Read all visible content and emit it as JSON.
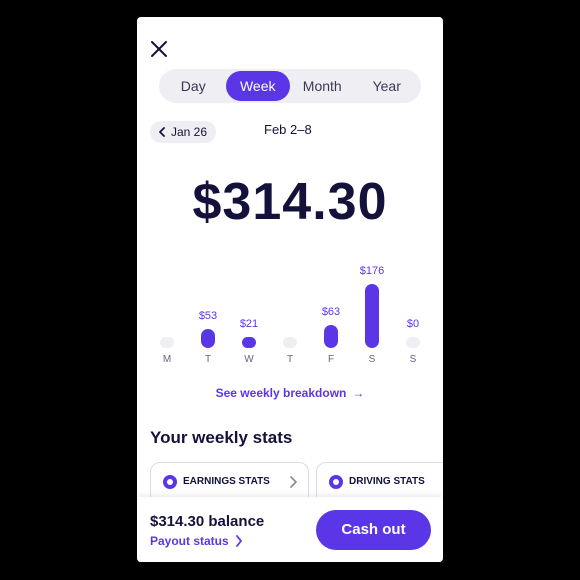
{
  "tabs": [
    {
      "label": "Day",
      "active": false
    },
    {
      "label": "Week",
      "active": true
    },
    {
      "label": "Month",
      "active": false
    },
    {
      "label": "Year",
      "active": false
    }
  ],
  "week_nav": {
    "prev_label": "Jan 26",
    "current_range": "Feb 2–8"
  },
  "total": "$314.30",
  "chart_data": {
    "type": "bar",
    "categories": [
      "M",
      "T",
      "W",
      "T",
      "F",
      "S",
      "S"
    ],
    "values": [
      0,
      53,
      21,
      0,
      63,
      176,
      0
    ],
    "value_labels": [
      "",
      "$53",
      "$21",
      "",
      "$63",
      "$176",
      "$0"
    ],
    "colors": {
      "bar": "#5b36e6",
      "empty": "#efeff3"
    }
  },
  "breakdown_link": "See weekly breakdown",
  "stats": {
    "heading": "Your weekly stats",
    "cards": [
      {
        "label": "EARNINGS STATS",
        "icon": "earnings-icon"
      },
      {
        "label": "DRIVING STATS",
        "icon": "car-icon"
      }
    ]
  },
  "footer": {
    "balance": "$314.30 balance",
    "payout_status": "Payout status",
    "cash_out": "Cash out"
  },
  "colors": {
    "accent": "#5b36e6",
    "text": "#14123a"
  }
}
